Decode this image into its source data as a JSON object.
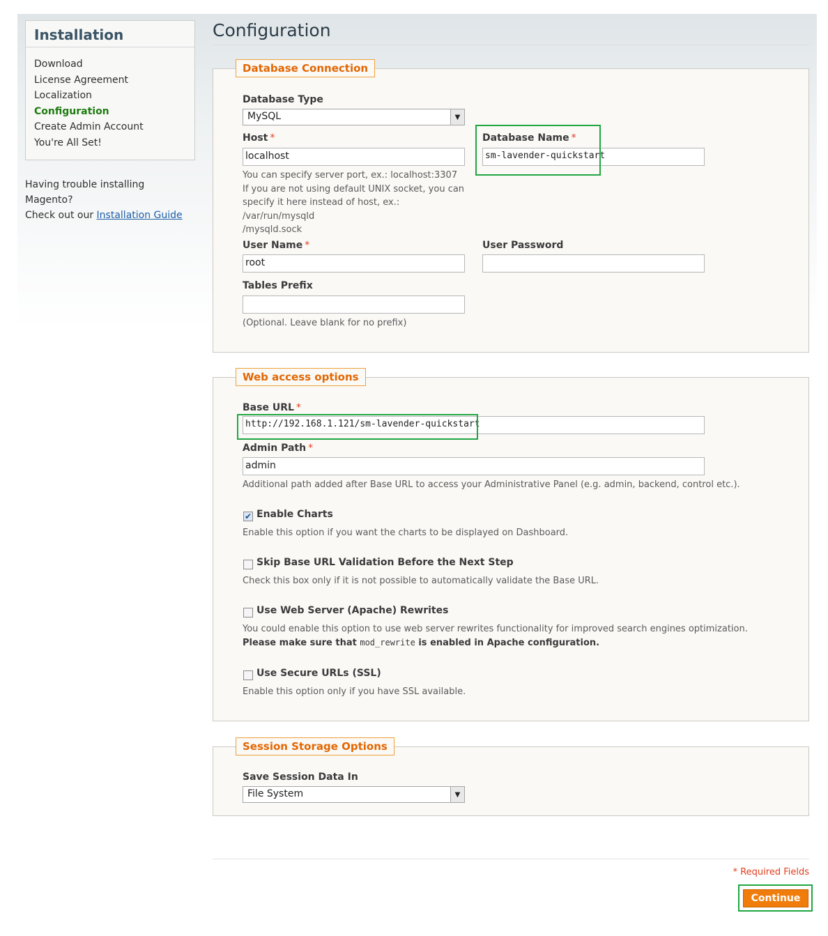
{
  "sidebar": {
    "title": "Installation",
    "steps": [
      "Download",
      "License Agreement",
      "Localization",
      "Configuration",
      "Create Admin Account",
      "You're All Set!"
    ],
    "active_step": "Configuration",
    "help_line1": "Having trouble installing Magento?",
    "help_line2_prefix": "Check out our ",
    "help_link": "Installation Guide"
  },
  "page_title": "Configuration",
  "required_mark": "*",
  "db": {
    "legend": "Database Connection",
    "type_label": "Database Type",
    "type_value": "MySQL",
    "host_label": "Host",
    "host_value": "localhost",
    "host_note_1": "You can specify server port, ex.: localhost:3307",
    "host_note_2": "If you are not using default UNIX socket, you can",
    "host_note_3": "specify it here instead of host, ex.: /var/run/mysqld",
    "host_note_4": "/mysqld.sock",
    "name_label": "Database Name",
    "name_value": "sm-lavender-quickstart",
    "user_label": "User Name",
    "user_value": "root",
    "password_label": "User Password",
    "password_value": "",
    "prefix_label": "Tables Prefix",
    "prefix_value": "",
    "prefix_note": "(Optional. Leave blank for no prefix)"
  },
  "web": {
    "legend": "Web access options",
    "base_url_label": "Base URL",
    "base_url_value": "http://192.168.1.121/sm-lavender-quickstart",
    "admin_path_label": "Admin Path",
    "admin_path_value": "admin",
    "admin_path_note": "Additional path added after Base URL to access your Administrative Panel (e.g. admin, backend, control etc.).",
    "charts_label": "Enable Charts",
    "charts_checked": true,
    "charts_note": "Enable this option if you want the charts to be displayed on Dashboard.",
    "skip_label": "Skip Base URL Validation Before the Next Step",
    "skip_checked": false,
    "skip_note": "Check this box only if it is not possible to automatically validate the Base URL.",
    "rewrites_label": "Use Web Server (Apache) Rewrites",
    "rewrites_checked": false,
    "rewrites_note": "You could enable this option to use web server rewrites functionality for improved search engines optimization.",
    "rewrites_note2_prefix": "Please make sure that ",
    "rewrites_note2_code": "mod_rewrite",
    "rewrites_note2_suffix": " is enabled in Apache configuration.",
    "ssl_label": "Use Secure URLs (SSL)",
    "ssl_checked": false,
    "ssl_note": "Enable this option only if you have SSL available."
  },
  "session": {
    "legend": "Session Storage Options",
    "save_label": "Save Session Data In",
    "save_value": "File System"
  },
  "required_fields": "* Required Fields",
  "continue_label": "Continue"
}
